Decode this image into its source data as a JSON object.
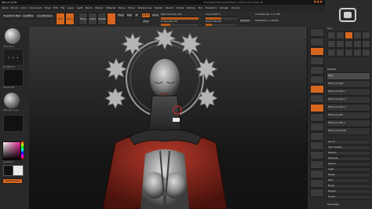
{
  "window": {
    "title": "ZBrush 2018",
    "status": "Free Mem 24.9   Active Mem 1,200   Scratch Disk 48"
  },
  "menu": {
    "items": [
      "Alpha",
      "Brush",
      "Color",
      "Document",
      "Draw",
      "Edit",
      "File",
      "Layer",
      "Light",
      "Macro",
      "Marker",
      "Material",
      "Movie",
      "Picker",
      "Preferences",
      "Render",
      "Stencil",
      "Stroke",
      "Texture",
      "Tool",
      "Transform",
      "Zplugin",
      "Zscript"
    ]
  },
  "top_shelf": {
    "projection_master": "Projection Master",
    "lightbox": "LightBox",
    "live_boolean": "Live Boolean",
    "edit": "Edit",
    "draw": "Draw",
    "move": "Move",
    "scale": "Scale",
    "rotate": "Rotate",
    "mrgb": "Mrgb",
    "rgb": "Rgb",
    "m": "M",
    "zadd": "Zadd",
    "zsub": "Zsub",
    "zcut": "Zcut",
    "rgb_intensity": "Rgb Intensity 100",
    "z_intensity": "Z Intensity 25",
    "focal_shift": "Focal Shift 0",
    "draw_size": "Draw Size 64",
    "dynamic": "Dynamic",
    "active_points": "ActivePoints: 2.11 Mil",
    "total_points": "TotalPoints: 3.26 Mil",
    "accent_color": "#d7671f"
  },
  "left_tray": {
    "brush": "Standard",
    "stroke": "DragRect",
    "alpha": "Alpha Off",
    "material": "MatCap Gray",
    "texture": "Texture Off",
    "gradient": "Gradient",
    "switch_color": "SwitchColor",
    "alternate": "Alternate",
    "main_color": "#e8e8e8"
  },
  "right_panel": {
    "tool_label": "Tool",
    "subtool_label": "Subtool",
    "subtools": [
      "Body",
      "PM3D_Circle3D",
      "PM3D_Circle3D_1",
      "PM3D_Circle3D_2",
      "PM3D_Circle3D_3",
      "PM3D_Cube3D",
      "PM3D_Cube3D_1",
      "PM3D_Cylinder3D"
    ],
    "actions": [
      "List All",
      "Auto Collapse",
      "Rename",
      "Duplicate",
      "Append",
      "Insert",
      "Delete",
      "Split",
      "Merge",
      "Remesh",
      "Project"
    ],
    "footer": "Geometry"
  },
  "brand": {
    "logo": "zbrush-logo"
  }
}
